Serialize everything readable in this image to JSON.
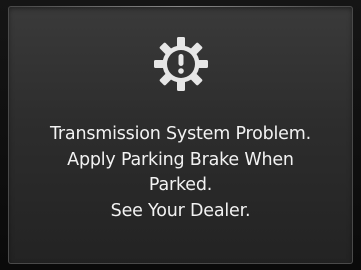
{
  "warning": {
    "icon": "gear-exclamation-icon",
    "icon_color": "#e6e6e6",
    "lines": [
      "Transmission System Problem.",
      "Apply Parking Brake When",
      "Parked.",
      "See Your Dealer."
    ]
  },
  "colors": {
    "screen_background": "#2f2f2f",
    "text": "#f2f2f2"
  }
}
